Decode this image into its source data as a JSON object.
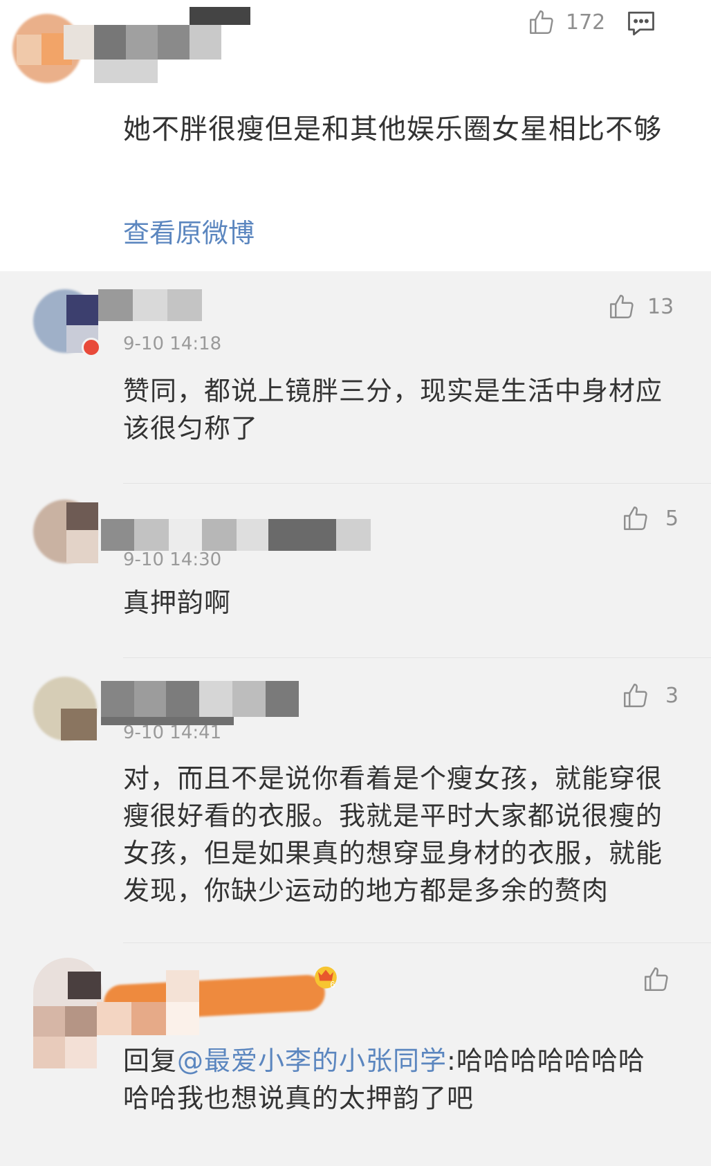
{
  "main_post": {
    "like_count": "172",
    "text": "她不胖很瘦但是和其他娱乐圈女星相比不够",
    "view_original_link": "查看原微博"
  },
  "replies": [
    {
      "time": "9-10 14:18",
      "like_count": "13",
      "text": "赞同，都说上镜胖三分，现实是生活中身材应该很匀称了"
    },
    {
      "time": "9-10 14:30",
      "like_count": "5",
      "text": "真押韵啊"
    },
    {
      "time": "9-10 14:41",
      "like_count": "3",
      "text": "对，而且不是说你看着是个瘦女孩，就能穿很瘦很好看的衣服。我就是平时大家都说很瘦的女孩，但是如果真的想穿显身材的衣服，就能发现，你缺少运动的地方都是多余的赘肉"
    },
    {
      "reply_prefix": "回复",
      "mention": "@最爱小李的小张同学",
      "text": ":哈哈哈哈哈哈哈哈哈我也想说真的太押韵了吧",
      "badge_level": "6"
    }
  ],
  "icons": [
    "thumbs-up-icon",
    "comment-icon",
    "vip-crown-badge"
  ],
  "colors": {
    "link": "#5b86bf",
    "muted": "#9a9a9a",
    "bg": "#f2f2f2",
    "highlight_orange": "#ee8a3e"
  }
}
